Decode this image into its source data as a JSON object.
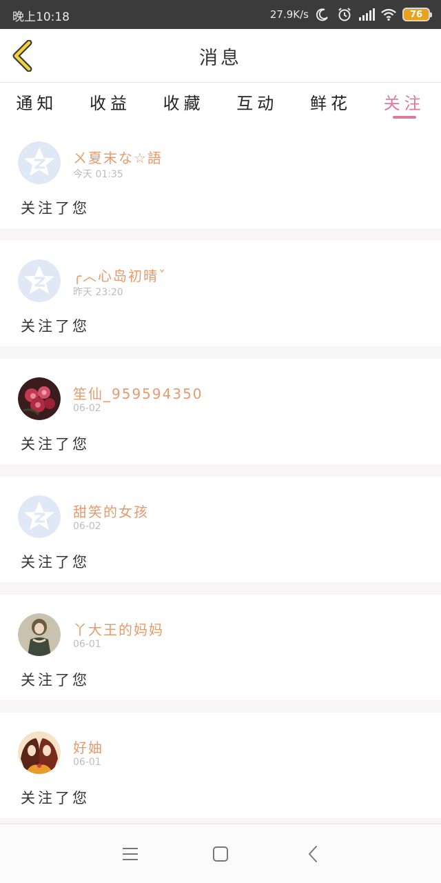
{
  "status_bar": {
    "time": "晚上10:18",
    "net_speed": "27.9K/s",
    "battery": "76",
    "icons": [
      "moon-icon",
      "alarm-icon",
      "signal-icon",
      "wifi-icon",
      "battery-icon"
    ]
  },
  "header": {
    "title": "消息",
    "back_icon": "chevron-left-icon"
  },
  "tabs": [
    {
      "label": "通知",
      "active": false
    },
    {
      "label": "收益",
      "active": false
    },
    {
      "label": "收藏",
      "active": false
    },
    {
      "label": "互动",
      "active": false
    },
    {
      "label": "鲜花",
      "active": false
    },
    {
      "label": "关注",
      "active": true
    }
  ],
  "items": [
    {
      "name": "ㄨ夏末な☆語",
      "time": "今天 01:35",
      "message": "关注了您",
      "avatar": "qzone-default"
    },
    {
      "name": "╭︿心岛初晴ˇ",
      "time": "昨天 23:20",
      "message": "关注了您",
      "avatar": "qzone-default"
    },
    {
      "name": "笙仙_959594350",
      "time": "06-02",
      "message": "关注了您",
      "avatar": "flowers-photo"
    },
    {
      "name": "甜笑的女孩",
      "time": "06-02",
      "message": "关注了您",
      "avatar": "qzone-default"
    },
    {
      "name": "丫大王的妈妈",
      "time": "06-01",
      "message": "关注了您",
      "avatar": "girl-photo"
    },
    {
      "name": "好妯",
      "time": "06-01",
      "message": "关注了您",
      "avatar": "anime-photo"
    }
  ],
  "nav": {
    "icons": [
      "menu-icon",
      "home-square-icon",
      "back-triangle-icon"
    ]
  },
  "colors": {
    "accent": "#e0789a",
    "username": "#e89a6c",
    "statusbar": "#3b3b3b",
    "battery": "#e8a21b"
  }
}
